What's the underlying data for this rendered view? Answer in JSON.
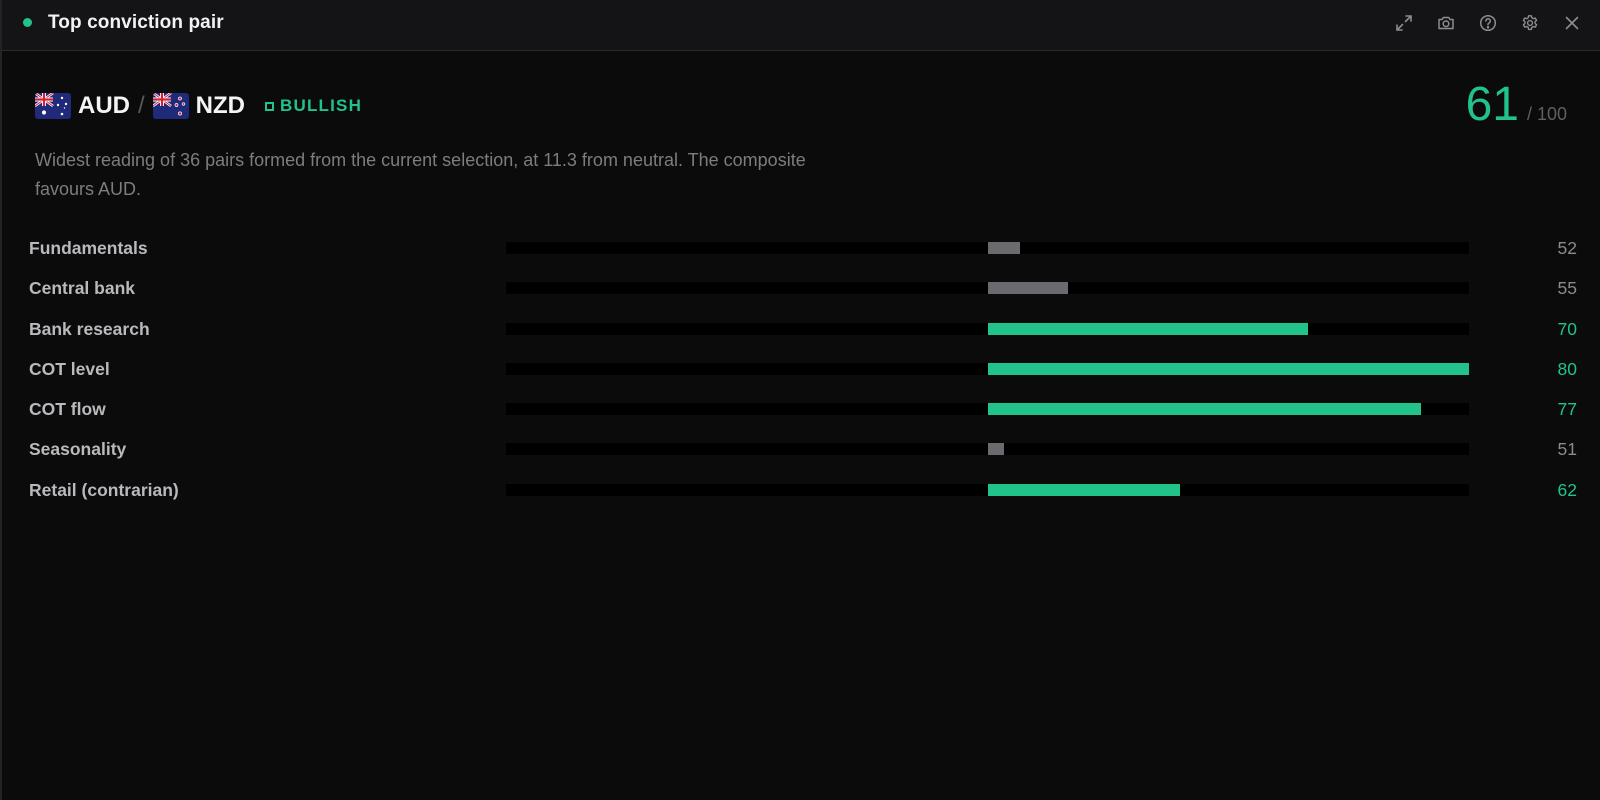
{
  "window": {
    "title": "Top conviction pair",
    "status_color": "#22c38a",
    "toolbar": [
      {
        "icon": "expand-icon",
        "name": "expand-button"
      },
      {
        "icon": "camera-icon",
        "name": "screenshot-button"
      },
      {
        "icon": "help-icon",
        "name": "help-button"
      },
      {
        "icon": "gear-icon",
        "name": "settings-button"
      },
      {
        "icon": "close-icon",
        "name": "close-button"
      }
    ]
  },
  "pair": {
    "base": "AUD",
    "separator": "/",
    "quote": "NZD",
    "base_flag": "australia-flag-icon",
    "quote_flag": "new-zealand-flag-icon",
    "bias": "BULLISH",
    "bias_color": "#22c38a"
  },
  "score": {
    "value": "61",
    "max": "/ 100",
    "color": "#22c38a"
  },
  "summary": "Widest reading of 36 pairs formed from the current selection, at 11.3 from neutral. The composite favours AUD.",
  "colors": {
    "positive": "#22c38a",
    "neutral": "#6b6b6f",
    "positive_text": "#22c38a",
    "neutral_text": "#8a8a90"
  },
  "chart_data": {
    "type": "bar",
    "orientation": "horizontal",
    "baseline": 50,
    "xlim": [
      20,
      80
    ],
    "categories": [
      "Fundamentals",
      "Central bank",
      "Bank research",
      "COT level",
      "COT flow",
      "Seasonality",
      "Retail (contrarian)"
    ],
    "values": [
      52,
      55,
      70,
      80,
      77,
      51,
      62
    ],
    "value_labels": [
      "52",
      "55",
      "70",
      "80",
      "77",
      "51",
      "62"
    ],
    "highlight": [
      false,
      false,
      true,
      true,
      true,
      false,
      true
    ]
  }
}
